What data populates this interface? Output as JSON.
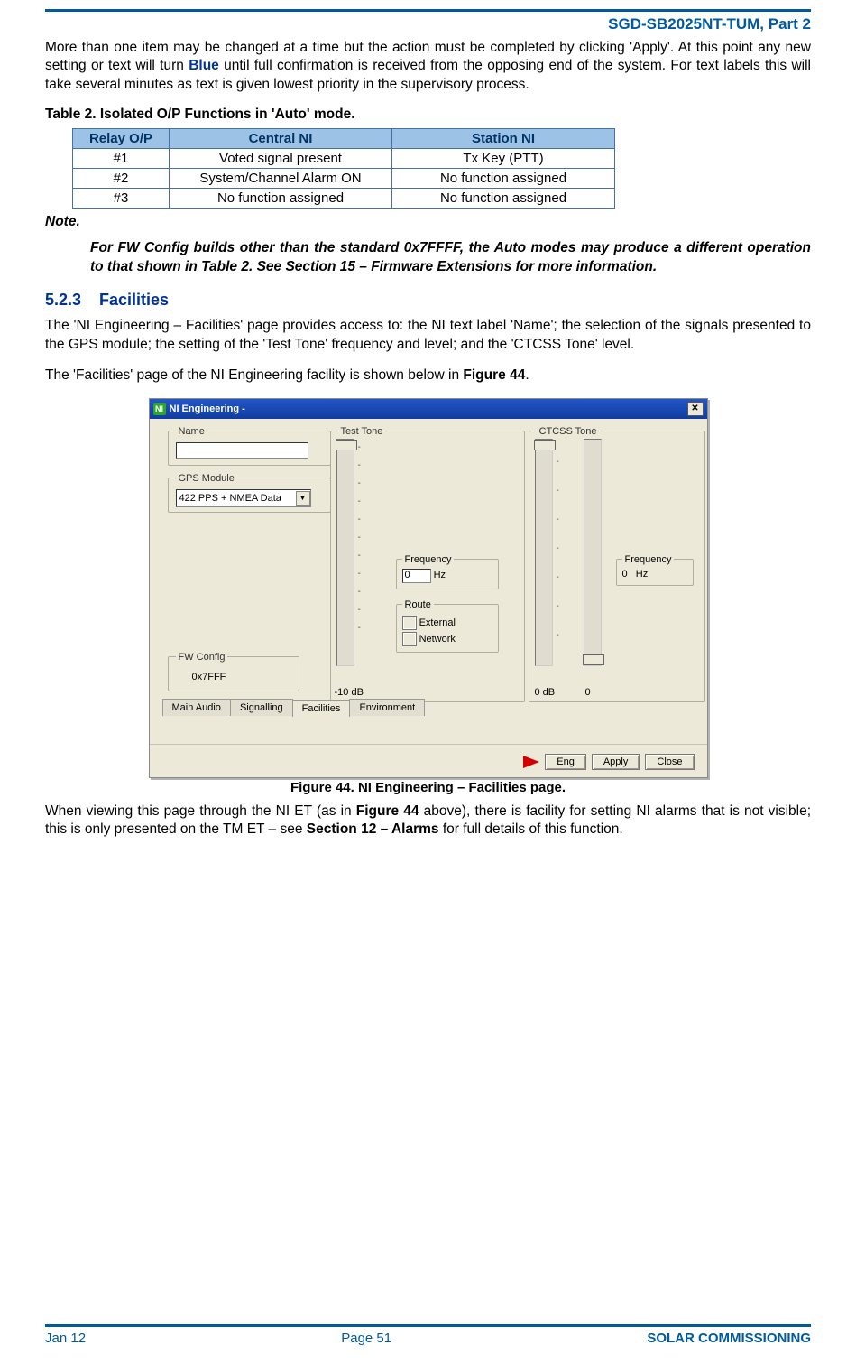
{
  "header": {
    "doc_id": "SGD-SB2025NT-TUM, Part 2"
  },
  "intro_para_pre": "More than one item may be changed at a time but the action must be completed by clicking 'Apply'. At this point any new setting or text will turn ",
  "intro_blue": "Blue",
  "intro_para_post": " until full confirmation is received from the opposing end of the system.  For text labels this will take several minutes as text is given lowest priority in the supervisory process.",
  "table2": {
    "caption": "Table 2.  Isolated O/P Functions in 'Auto' mode.",
    "headers": {
      "relay": "Relay O/P",
      "central": "Central NI",
      "station": "Station NI"
    },
    "rows": [
      {
        "relay": "#1",
        "central": "Voted signal present",
        "station": "Tx Key (PTT)"
      },
      {
        "relay": "#2",
        "central": "System/Channel Alarm ON",
        "station": "No function assigned"
      },
      {
        "relay": "#3",
        "central": "No function assigned",
        "station": "No function assigned"
      }
    ]
  },
  "note": {
    "label": "Note.",
    "body": "For FW Config builds other than the standard 0x7FFFF, the Auto modes may produce a different operation to that shown in Table 2.  See Section 15 – Firmware Extensions for more information."
  },
  "section": {
    "num": "5.2.3",
    "title": "Facilities",
    "p1": "The 'NI Engineering – Facilities' page provides access to: the NI text label 'Name'; the selection of the signals presented to the GPS module; the setting of the 'Test Tone' frequency and level; and the 'CTCSS Tone' level.",
    "p2_pre": "The 'Facilities' page of the NI Engineering facility is shown below in ",
    "p2_fig": "Figure 44",
    "p2_post": "."
  },
  "figure": {
    "caption": "Figure 44.  NI Engineering – Facilities page.",
    "dialog": {
      "title": "NI Engineering -",
      "groups": {
        "name": "Name",
        "gps": "GPS Module",
        "gps_value": "422 PPS + NMEA Data",
        "fw": "FW Config",
        "fw_value": "0x7FFF",
        "tt": "Test Tone",
        "tt_bottom": "-10 dB",
        "tt_freq_legend": "Frequency",
        "tt_freq_val": "0",
        "tt_freq_unit": "Hz",
        "tt_route_legend": "Route",
        "tt_route_ext": "External",
        "tt_route_net": "Network",
        "ct": "CTCSS Tone",
        "ct_bottom_l": "0 dB",
        "ct_bottom_r": "0",
        "ct_freq_legend": "Frequency",
        "ct_freq_val": "0",
        "ct_freq_unit": "Hz"
      },
      "tabs": {
        "t1": "Main Audio",
        "t2": "Signalling",
        "t3": "Facilities",
        "t4": "Environment"
      },
      "buttons": {
        "eng": "Eng",
        "apply": "Apply",
        "close": "Close"
      }
    }
  },
  "after_fig": {
    "pre": "When viewing this page through the NI ET (as in ",
    "fig": "Figure 44",
    "mid": " above), there is facility for setting NI alarms that is not visible; this is only presented on the TM ET – see ",
    "sec": "Section 12 – Alarms",
    "post": " for full details of this function."
  },
  "footer": {
    "left": "Jan 12",
    "center": "Page 51",
    "right": "SOLAR COMMISSIONING"
  }
}
